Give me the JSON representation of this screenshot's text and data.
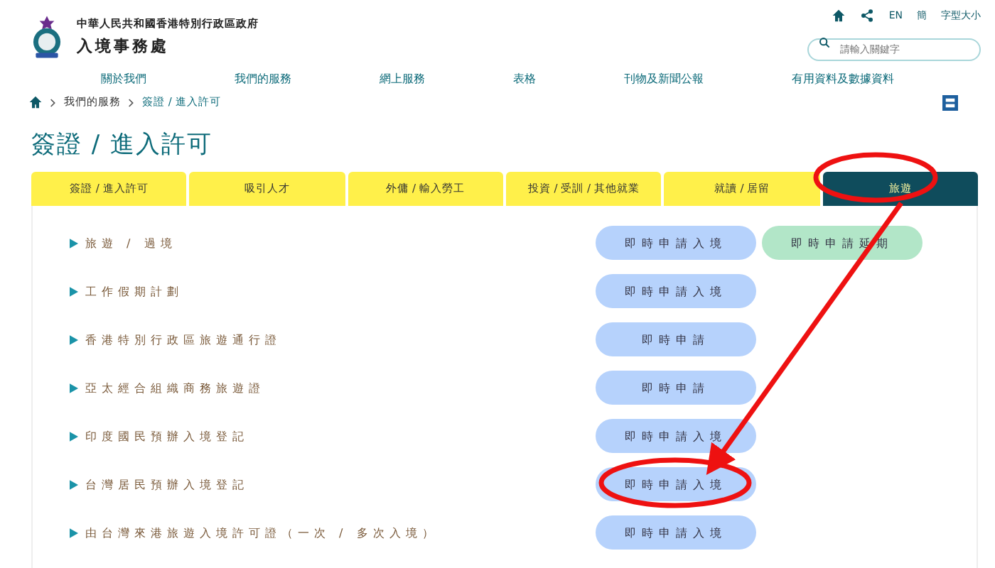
{
  "header": {
    "org_line": "中華人民共和國香港特別行政區政府",
    "department": "入境事務處",
    "links": [
      "EN",
      "簡",
      "字型大小"
    ],
    "search": {
      "placeholder": "請輸入關鍵字"
    }
  },
  "nav": [
    "關於我們",
    "我們的服務",
    "網上服務",
    "表格",
    "刊物及新聞公報",
    "有用資料及數據資料"
  ],
  "breadcrumb": [
    "我們的服務",
    "簽證 / 進入許可"
  ],
  "page_title": "簽證 / 進入許可",
  "tabs": [
    {
      "label": "簽證 / 進入許可",
      "selected": false
    },
    {
      "label": "吸引人才",
      "selected": false
    },
    {
      "label": "外傭 / 輸入勞工",
      "selected": false
    },
    {
      "label": "投資 / 受訓 / 其他就業",
      "selected": false
    },
    {
      "label": "就讀 / 居留",
      "selected": false
    },
    {
      "label": "旅遊",
      "selected": true
    }
  ],
  "rows": [
    {
      "label": "旅遊 / 過境",
      "buttons": [
        {
          "label": "即時申請入境",
          "kind": "primary"
        },
        {
          "label": "即時申請延期",
          "kind": "secondary"
        }
      ]
    },
    {
      "label": "工作假期計劃",
      "buttons": [
        {
          "label": "即時申請入境",
          "kind": "primary"
        }
      ]
    },
    {
      "label": "香港特別行政區旅遊通行證",
      "buttons": [
        {
          "label": "即時申請",
          "kind": "primary"
        }
      ]
    },
    {
      "label": "亞太經合組織商務旅遊證",
      "buttons": [
        {
          "label": "即時申請",
          "kind": "primary"
        }
      ]
    },
    {
      "label": "印度國民預辦入境登記",
      "buttons": [
        {
          "label": "即時申請入境",
          "kind": "primary"
        }
      ]
    },
    {
      "label": "台灣居民預辦入境登記",
      "buttons": [
        {
          "label": "即時申請入境",
          "kind": "primary"
        }
      ]
    },
    {
      "label": "由台灣來港旅遊入境許可證（一次 / 多次入境）",
      "buttons": [
        {
          "label": "即時申請入境",
          "kind": "primary"
        }
      ]
    }
  ],
  "annotations": [
    {
      "kind": "ellipse"
    },
    {
      "kind": "arrow"
    },
    {
      "kind": "ellipse"
    }
  ]
}
